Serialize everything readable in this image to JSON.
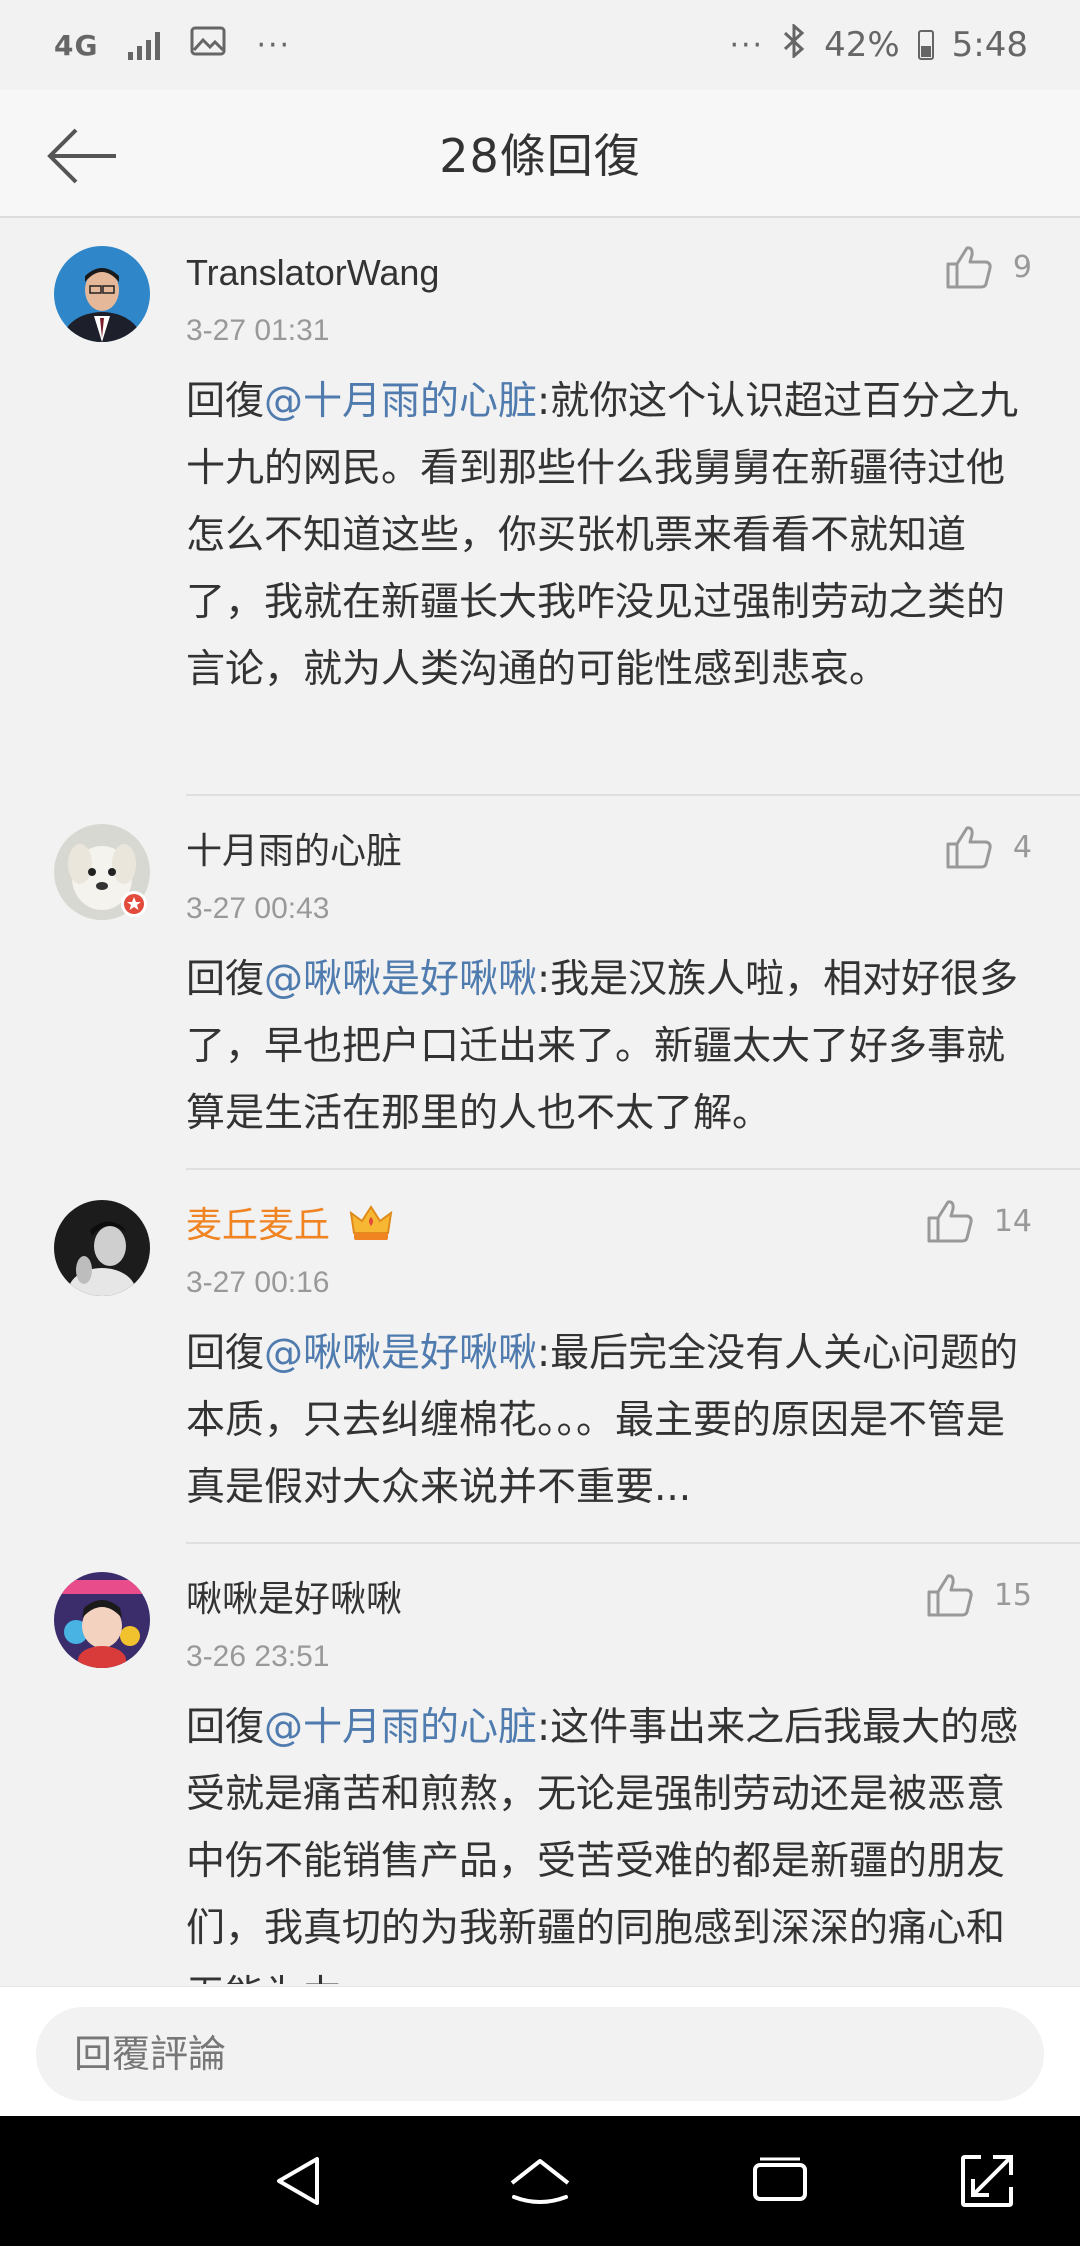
{
  "status_bar": {
    "network": "4G",
    "more": "···",
    "more_right": "···",
    "battery": "42%",
    "time": "5:48"
  },
  "header": {
    "title": "28條回復"
  },
  "comments": [
    {
      "name": "TranslatorWang",
      "time": "3-27 01:31",
      "likes": "9",
      "prefix": "回復",
      "mention": "@十月雨的心脏",
      "text": ":就你这个认识超过百分之九十九的网民。看到那些什么我舅舅在新疆待过他怎么不知道这些，你买张机票来看看不就知道了，我就在新疆长大我咋没见过强制劳动之类的言论，就为人类沟通的可能性感到悲哀。"
    },
    {
      "name": "十月雨的心脏",
      "time": "3-27 00:43",
      "likes": "4",
      "prefix": "回復",
      "mention": "@啾啾是好啾啾",
      "text": ":我是汉族人啦，相对好很多了，早也把户口迁出来了。新疆太大了好多事就算是生活在那里的人也不太了解。"
    },
    {
      "name": "麦丘麦丘",
      "time": "3-27 00:16",
      "likes": "14",
      "prefix": "回復",
      "mention": "@啾啾是好啾啾",
      "text": ":最后完全没有人关心问题的本质，只去纠缠棉花。。。最主要的原因是不管是真是假对大众来说并不重要..."
    },
    {
      "name": "啾啾是好啾啾",
      "time": "3-26 23:51",
      "likes": "15",
      "prefix": "回復",
      "mention": "@十月雨的心脏",
      "text": ":这件事出来之后我最大的感受就是痛苦和煎熬，无论是强制劳动还是被恶意中伤不能销售产品，受苦受难的都是新疆的朋友们，我真切的为我新疆的同胞感到深深的痛心和无能为力。"
    }
  ],
  "reply_bar": {
    "placeholder": "回覆評論"
  },
  "colors": {
    "mention": "#4f7bae",
    "vip_name": "#f08322",
    "meta": "#999999"
  }
}
